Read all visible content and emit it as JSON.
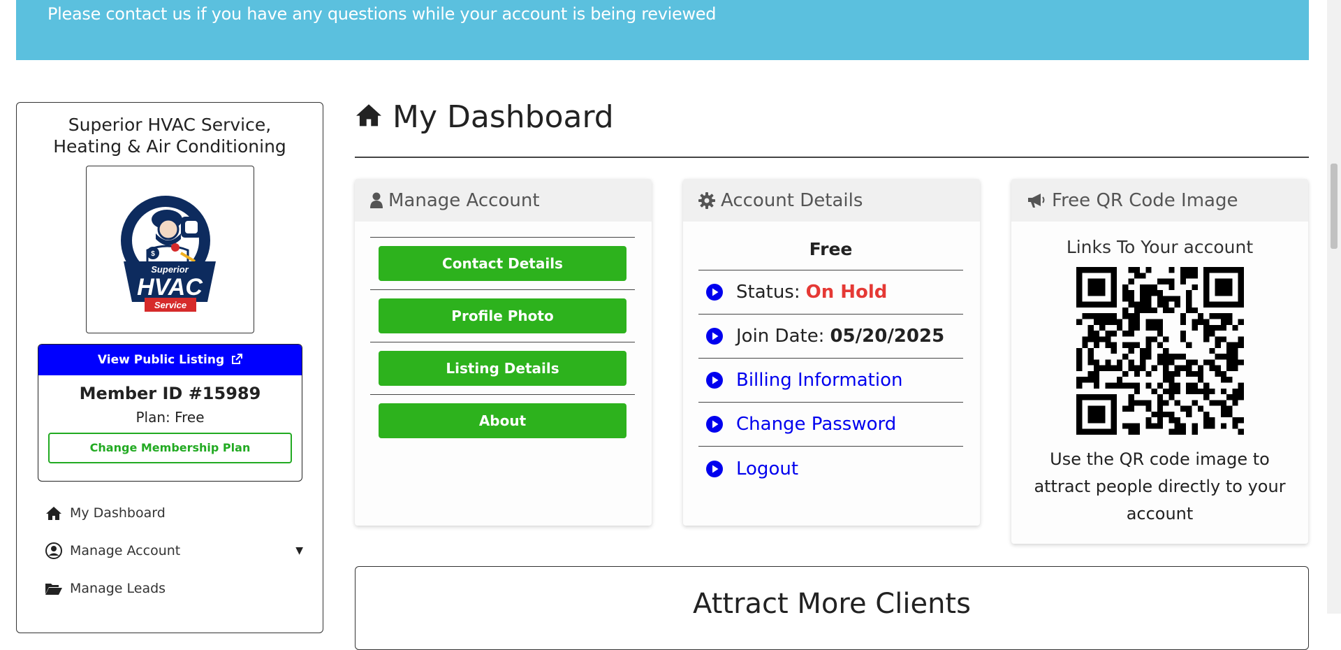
{
  "banner": {
    "text": "Please contact us if you have any questions while your account is being reviewed"
  },
  "sidebar": {
    "company_name_line1": "Superior HVAC Service,",
    "company_name_line2": "Heating & Air Conditioning",
    "logo": {
      "top_text": "Superior",
      "main_text": "HVAC",
      "ribbon_text": "Service"
    },
    "view_listing_label": "View Public Listing",
    "member_id": "Member ID #15989",
    "plan": "Plan: Free",
    "change_plan_label": "Change Membership Plan",
    "nav": [
      {
        "label": "My Dashboard",
        "icon": "home-icon"
      },
      {
        "label": "Manage Account",
        "icon": "user-circle-icon"
      },
      {
        "label": "Manage Leads",
        "icon": "folder-open-icon"
      }
    ]
  },
  "main": {
    "title": "My Dashboard",
    "manage_account": {
      "header": "Manage Account",
      "buttons": [
        "Contact Details",
        "Profile Photo",
        "Listing Details",
        "About"
      ]
    },
    "account_details": {
      "header": "Account Details",
      "plan": "Free",
      "status_label": "Status:",
      "status_value": "On Hold",
      "join_label": "Join Date:",
      "join_value": "05/20/2025",
      "billing_label": "Billing Information",
      "password_label": "Change Password",
      "logout_label": "Logout"
    },
    "qr": {
      "header": "Free QR Code Image",
      "caption": "Links To Your account",
      "description": "Use the QR code image to attract people directly to your account"
    },
    "attract": {
      "title": "Attract More Clients"
    }
  },
  "colors": {
    "banner": "#5bc0de",
    "primary_button": "#0000ff",
    "green_button": "#2db21d",
    "status_red": "#e53935",
    "link_blue": "#0000ee"
  }
}
